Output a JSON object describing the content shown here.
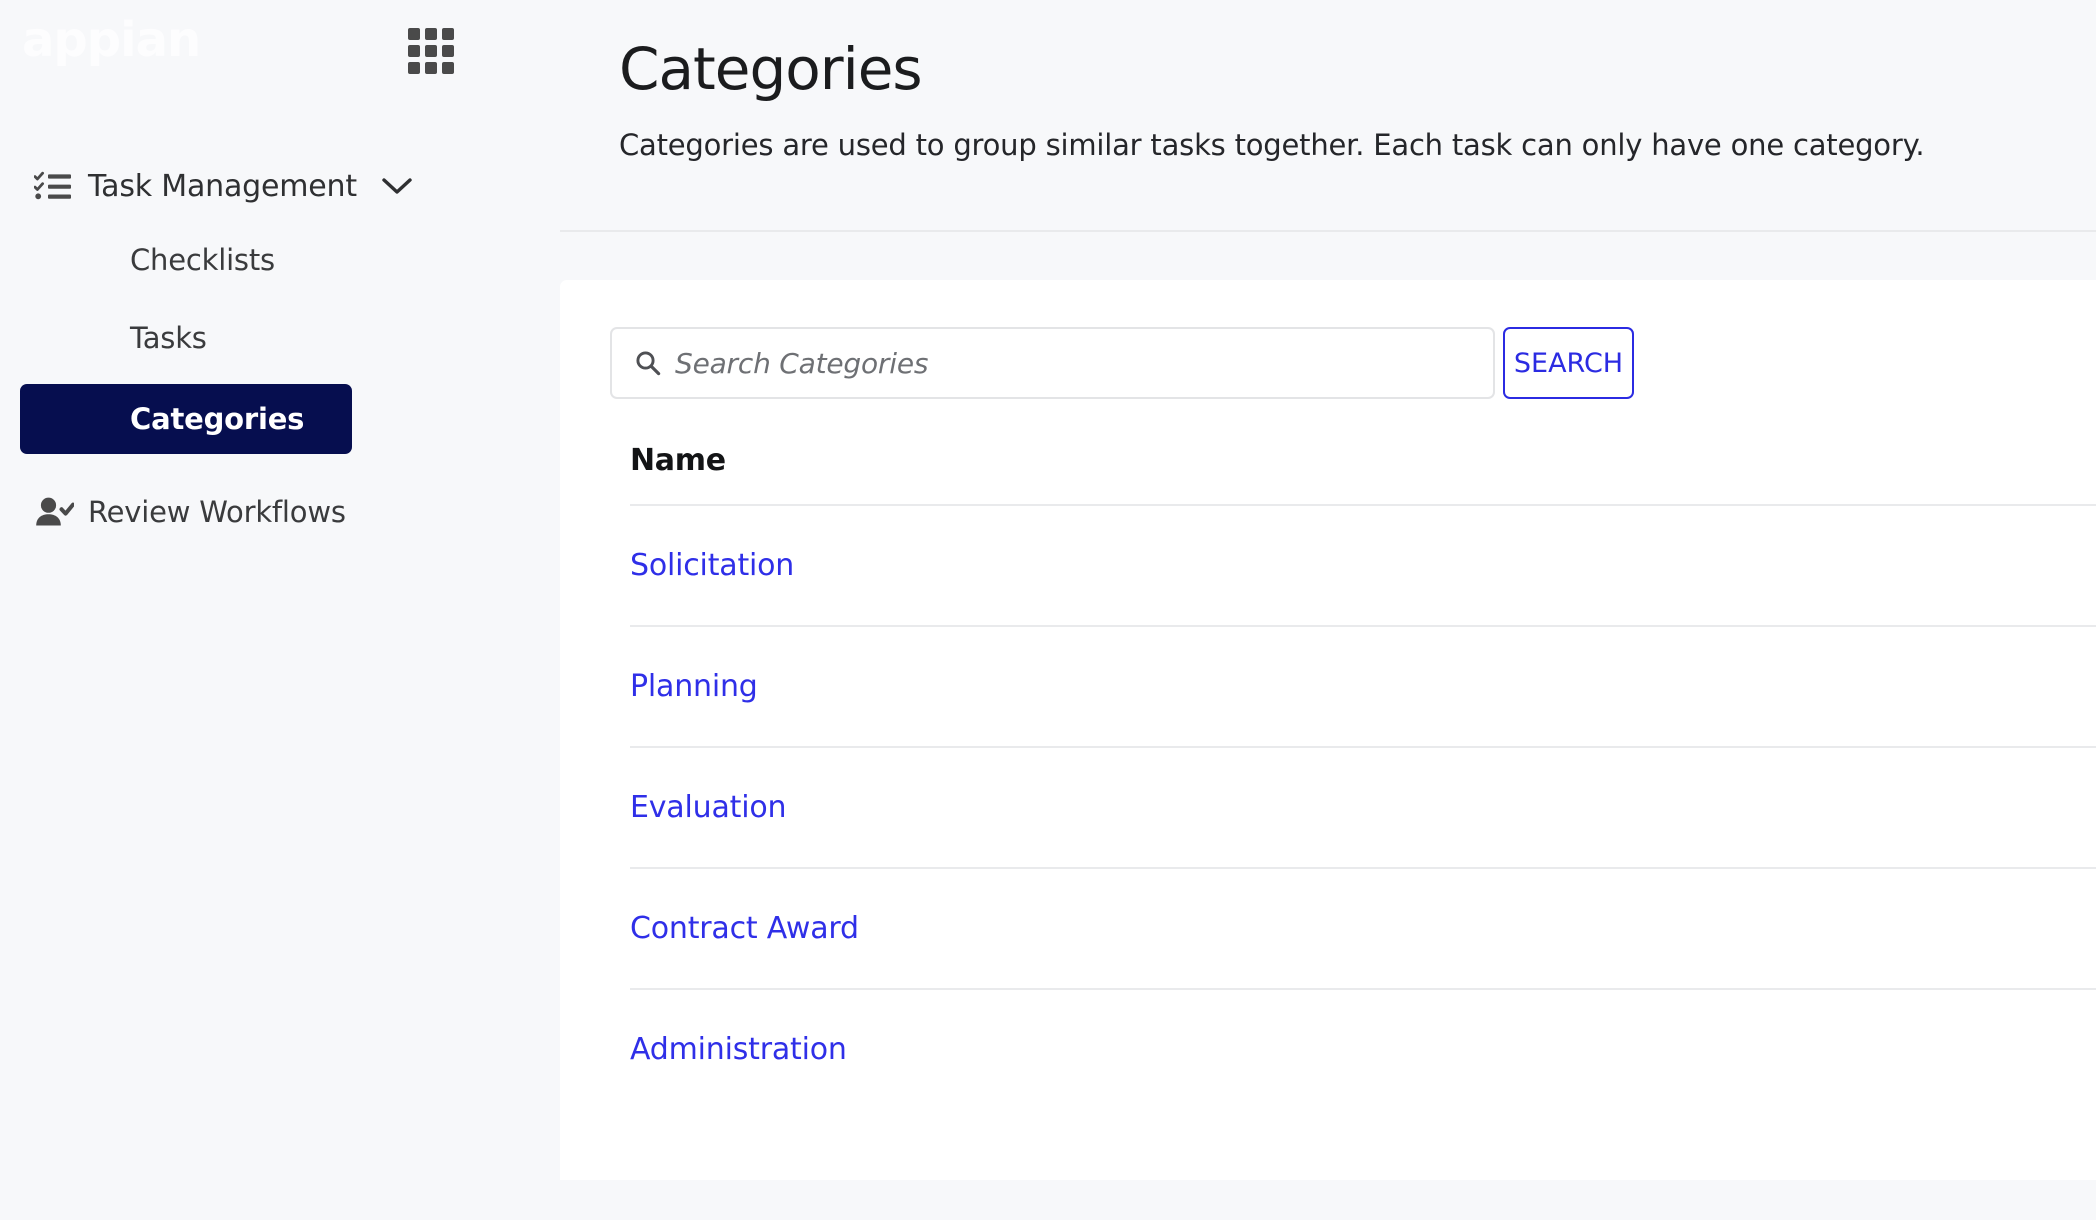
{
  "brand": {
    "logo_text": "appian",
    "logo_color": "#fdfdfe",
    "apps_icon": "grid-apps-icon"
  },
  "sidebar": {
    "group": {
      "label": "Task Management",
      "icon": "checklist-icon",
      "chevron": "chevron-down-icon",
      "expanded": true
    },
    "items": [
      {
        "label": "Checklists",
        "selected": false,
        "icon": null
      },
      {
        "label": "Tasks",
        "selected": false,
        "icon": null
      },
      {
        "label": "Categories",
        "selected": true,
        "icon": null
      },
      {
        "label": "Review Workflows",
        "selected": false,
        "icon": "user-check-icon"
      }
    ],
    "selected_bg": "#060E4F",
    "background": "#f7f8fa"
  },
  "header": {
    "title": "Categories",
    "description": "Categories are used to group similar tasks together. Each task can only have one category."
  },
  "search": {
    "placeholder": "Search Categories",
    "value": "",
    "icon": "search-icon",
    "button_label": "SEARCH",
    "button_color": "#2B2BE2"
  },
  "table": {
    "columns": [
      "Name"
    ],
    "link_color": "#2F2FE8",
    "rows": [
      {
        "name": "Solicitation"
      },
      {
        "name": "Planning"
      },
      {
        "name": "Evaluation"
      },
      {
        "name": "Contract Award"
      },
      {
        "name": "Administration"
      }
    ]
  }
}
